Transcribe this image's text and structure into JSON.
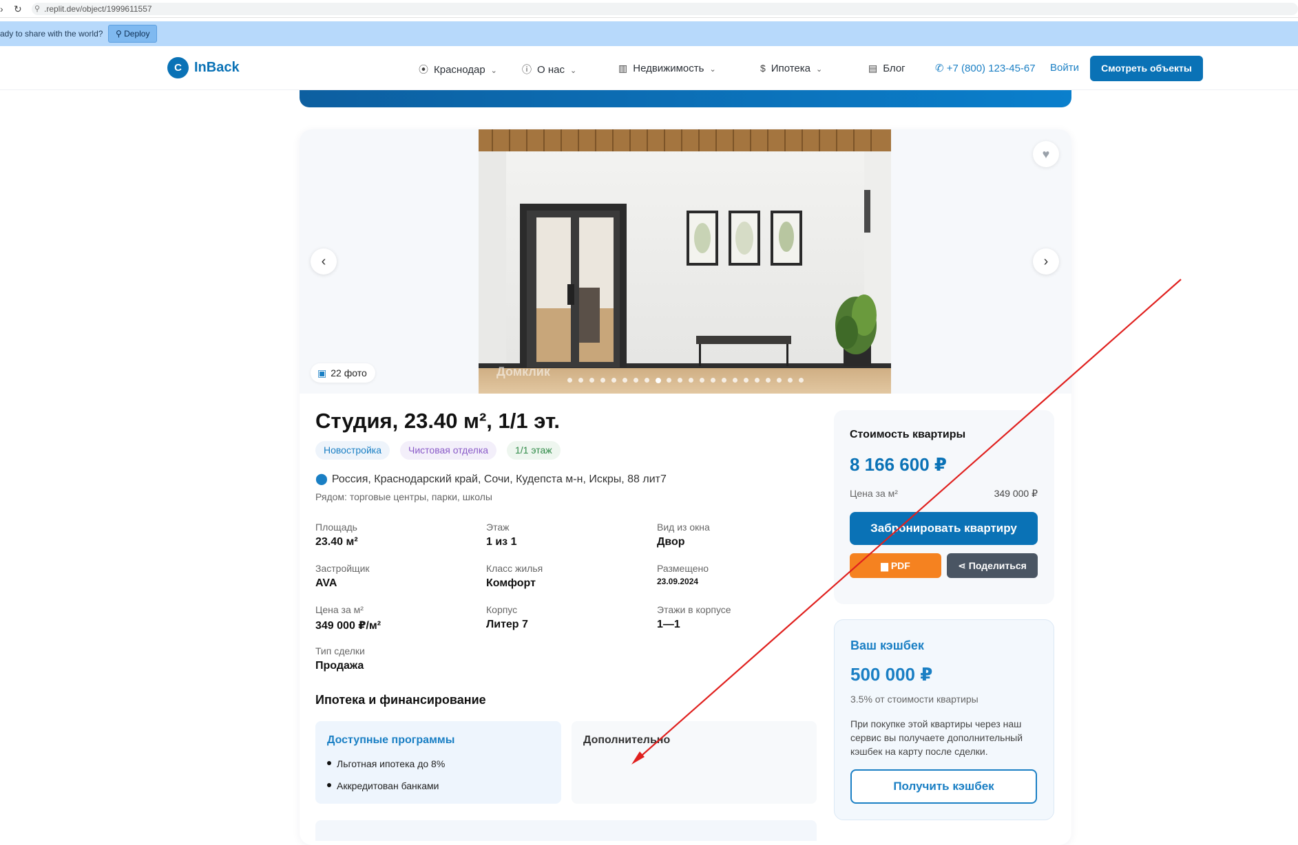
{
  "browser": {
    "url": ".replit.dev/object/1999611557"
  },
  "replit": {
    "message": "ady to share with the world?",
    "deploy_label": "Deploy"
  },
  "header": {
    "logo_letter": "C",
    "logo_text": "InBack",
    "nav": [
      {
        "label": "Краснодар",
        "icon": "location-pin-icon"
      },
      {
        "label": "О нас",
        "icon": "info-icon"
      },
      {
        "label": "Недвижимость",
        "icon": "building-icon"
      },
      {
        "label": "Ипотека",
        "icon": "dollar-icon"
      },
      {
        "label": "Блог",
        "icon": "newspaper-icon"
      }
    ],
    "phone": "+7 (800) 123-45-67",
    "login": "Войти",
    "cta": "Смотреть объекты"
  },
  "gallery": {
    "photo_count": "22 фото",
    "watermark": "Домклик",
    "total_slides": 22,
    "active_slide": 8
  },
  "listing": {
    "title": "Студия, 23.40 м², 1/1 эт.",
    "tags": [
      "Новостройка",
      "Чистовая отделка",
      "1/1 этаж"
    ],
    "address": "Россия, Краснодарский край, Сочи, Кудепста м-н, Искры, 88 лит7",
    "nearby": "Рядом: торговые центры, парки, школы",
    "props": [
      {
        "label": "Площадь",
        "value": "23.40 м²"
      },
      {
        "label": "Этаж",
        "value": "1 из 1"
      },
      {
        "label": "Вид из окна",
        "value": "Двор"
      },
      {
        "label": "Застройщик",
        "value": "AVA"
      },
      {
        "label": "Класс жилья",
        "value": "Комфорт"
      },
      {
        "label": "Размещено",
        "value": "23.09.2024"
      },
      {
        "label": "Цена за м²",
        "value": "349 000 ₽/м²"
      },
      {
        "label": "Корпус",
        "value": "Литер 7"
      },
      {
        "label": "Этажи в корпусе",
        "value": "1—1"
      },
      {
        "label": "Тип сделки",
        "value": "Продажа"
      }
    ],
    "mortgage_section": "Ипотека и финансирование",
    "programs_title": "Доступные программы",
    "programs": [
      "Льготная ипотека до 8%",
      "Аккредитован банками"
    ],
    "additional_title": "Дополнительно"
  },
  "price": {
    "label": "Стоимость квартиры",
    "amount": "8 166 600 ₽",
    "sqm_label": "Цена за м²",
    "sqm_value": "349 000 ₽",
    "book_button": "Забронировать квартиру",
    "pdf_button": "PDF",
    "share_button": "Поделиться"
  },
  "cashback": {
    "title": "Ваш кэшбек",
    "amount": "500 000 ₽",
    "percent": "3.5% от стоимости квартиры",
    "description": "При покупке этой квартиры через наш сервис вы получаете дополнительный кэшбек на карту после сделки.",
    "button": "Получить кэшбек"
  },
  "colors": {
    "brand": "#0a72b6",
    "accent_orange": "#f58220",
    "annotation_red": "#e0201e"
  }
}
